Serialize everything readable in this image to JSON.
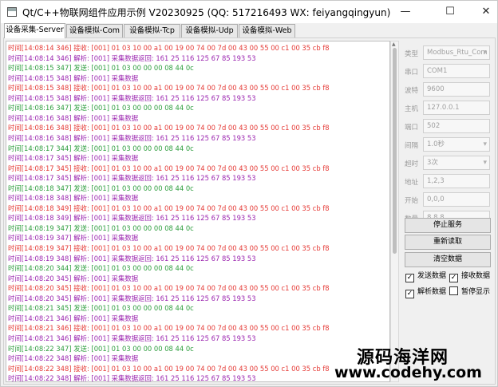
{
  "window": {
    "title": "Qt/C++物联网组件应用示例 V20230925 (QQ: 517216493 WX: feiyangqingyun)",
    "minimize_glyph": "—",
    "maximize_glyph": "☐",
    "close_glyph": "✕"
  },
  "tabs": [
    {
      "label": "设备采集-Server",
      "active": true
    },
    {
      "label": "设备模拟-Com",
      "active": false
    },
    {
      "label": "设备模拟-Tcp",
      "active": false
    },
    {
      "label": "设备模拟-Udp",
      "active": false
    },
    {
      "label": "设备模拟-Web",
      "active": false
    }
  ],
  "log": {
    "colors": {
      "recv": "#e53935",
      "parse": "#9c27b0",
      "send": "#2e9e3e"
    },
    "lines": [
      {
        "type": "recv",
        "text": "时间[14:08:14 346] 接收: [001] 01 03 10 00 a1 00 19 00 74 00 7d 00 43 00 55 00 c1 00 35 cb f8"
      },
      {
        "type": "parse",
        "text": "时间[14:08:14 346] 解析: [001] 采集数据返回: 161 25 116 125 67 85 193 53"
      },
      {
        "type": "send",
        "text": "时间[14:08:15 347] 发送: [001] 01 03 00 00 00 08 44 0c"
      },
      {
        "type": "parse",
        "text": "时间[14:08:15 348] 解析: [001] 采集数据"
      },
      {
        "type": "recv",
        "text": "时间[14:08:15 348] 接收: [001] 01 03 10 00 a1 00 19 00 74 00 7d 00 43 00 55 00 c1 00 35 cb f8"
      },
      {
        "type": "parse",
        "text": "时间[14:08:15 348] 解析: [001] 采集数据返回: 161 25 116 125 67 85 193 53"
      },
      {
        "type": "send",
        "text": "时间[14:08:16 347] 发送: [001] 01 03 00 00 00 08 44 0c"
      },
      {
        "type": "parse",
        "text": "时间[14:08:16 348] 解析: [001] 采集数据"
      },
      {
        "type": "recv",
        "text": "时间[14:08:16 348] 接收: [001] 01 03 10 00 a1 00 19 00 74 00 7d 00 43 00 55 00 c1 00 35 cb f8"
      },
      {
        "type": "parse",
        "text": "时间[14:08:16 348] 解析: [001] 采集数据返回: 161 25 116 125 67 85 193 53"
      },
      {
        "type": "send",
        "text": "时间[14:08:17 344] 发送: [001] 01 03 00 00 00 08 44 0c"
      },
      {
        "type": "parse",
        "text": "时间[14:08:17 345] 解析: [001] 采集数据"
      },
      {
        "type": "recv",
        "text": "时间[14:08:17 345] 接收: [001] 01 03 10 00 a1 00 19 00 74 00 7d 00 43 00 55 00 c1 00 35 cb f8"
      },
      {
        "type": "parse",
        "text": "时间[14:08:17 345] 解析: [001] 采集数据返回: 161 25 116 125 67 85 193 53"
      },
      {
        "type": "send",
        "text": "时间[14:08:18 347] 发送: [001] 01 03 00 00 00 08 44 0c"
      },
      {
        "type": "parse",
        "text": "时间[14:08:18 348] 解析: [001] 采集数据"
      },
      {
        "type": "recv",
        "text": "时间[14:08:18 349] 接收: [001] 01 03 10 00 a1 00 19 00 74 00 7d 00 43 00 55 00 c1 00 35 cb f8"
      },
      {
        "type": "parse",
        "text": "时间[14:08:18 349] 解析: [001] 采集数据返回: 161 25 116 125 67 85 193 53"
      },
      {
        "type": "send",
        "text": "时间[14:08:19 347] 发送: [001] 01 03 00 00 00 08 44 0c"
      },
      {
        "type": "parse",
        "text": "时间[14:08:19 347] 解析: [001] 采集数据"
      },
      {
        "type": "recv",
        "text": "时间[14:08:19 347] 接收: [001] 01 03 10 00 a1 00 19 00 74 00 7d 00 43 00 55 00 c1 00 35 cb f8"
      },
      {
        "type": "parse",
        "text": "时间[14:08:19 348] 解析: [001] 采集数据返回: 161 25 116 125 67 85 193 53"
      },
      {
        "type": "send",
        "text": "时间[14:08:20 344] 发送: [001] 01 03 00 00 00 08 44 0c"
      },
      {
        "type": "parse",
        "text": "时间[14:08:20 345] 解析: [001] 采集数据"
      },
      {
        "type": "recv",
        "text": "时间[14:08:20 345] 接收: [001] 01 03 10 00 a1 00 19 00 74 00 7d 00 43 00 55 00 c1 00 35 cb f8"
      },
      {
        "type": "parse",
        "text": "时间[14:08:20 345] 解析: [001] 采集数据返回: 161 25 116 125 67 85 193 53"
      },
      {
        "type": "send",
        "text": "时间[14:08:21 345] 发送: [001] 01 03 00 00 00 08 44 0c"
      },
      {
        "type": "parse",
        "text": "时间[14:08:21 346] 解析: [001] 采集数据"
      },
      {
        "type": "recv",
        "text": "时间[14:08:21 346] 接收: [001] 01 03 10 00 a1 00 19 00 74 00 7d 00 43 00 55 00 c1 00 35 cb f8"
      },
      {
        "type": "parse",
        "text": "时间[14:08:21 346] 解析: [001] 采集数据返回: 161 25 116 125 67 85 193 53"
      },
      {
        "type": "send",
        "text": "时间[14:08:22 347] 发送: [001] 01 03 00 00 00 08 44 0c"
      },
      {
        "type": "parse",
        "text": "时间[14:08:22 348] 解析: [001] 采集数据"
      },
      {
        "type": "recv",
        "text": "时间[14:08:22 348] 接收: [001] 01 03 10 00 a1 00 19 00 74 00 7d 00 43 00 55 00 c1 00 35 cb f8"
      },
      {
        "type": "parse",
        "text": "时间[14:08:22 348] 解析: [001] 采集数据返回: 161 25 116 125 67 85 193 53"
      }
    ]
  },
  "settings": {
    "fields": [
      {
        "label": "类型",
        "value": "Modbus_Rtu_Com",
        "combo": true
      },
      {
        "label": "串口",
        "value": "COM1",
        "combo": false
      },
      {
        "label": "波特",
        "value": "9600",
        "combo": false
      },
      {
        "label": "主机",
        "value": "127.0.0.1",
        "combo": false
      },
      {
        "label": "端口",
        "value": "502",
        "combo": false
      },
      {
        "label": "间隔",
        "value": "1.0秒",
        "combo": true
      },
      {
        "label": "超时",
        "value": "3次",
        "combo": true
      },
      {
        "label": "地址",
        "value": "1,2,3",
        "combo": false
      },
      {
        "label": "开始",
        "value": "0,0,0",
        "combo": false
      },
      {
        "label": "数量",
        "value": "8,8,8",
        "combo": false
      }
    ]
  },
  "actions": {
    "stop_service": "停止服务",
    "reload": "重新读取",
    "clear_data": "清空数据"
  },
  "checks": {
    "send_data": {
      "label": "发送数据",
      "checked": true
    },
    "recv_data": {
      "label": "接收数据",
      "checked": true
    },
    "parse_data": {
      "label": "解析数据",
      "checked": true
    },
    "pause_display": {
      "label": "暂停显示",
      "checked": false
    }
  },
  "check_glyph": "✓",
  "watermark": {
    "cn": "源码海洋网",
    "url": "www.codehy.com"
  }
}
